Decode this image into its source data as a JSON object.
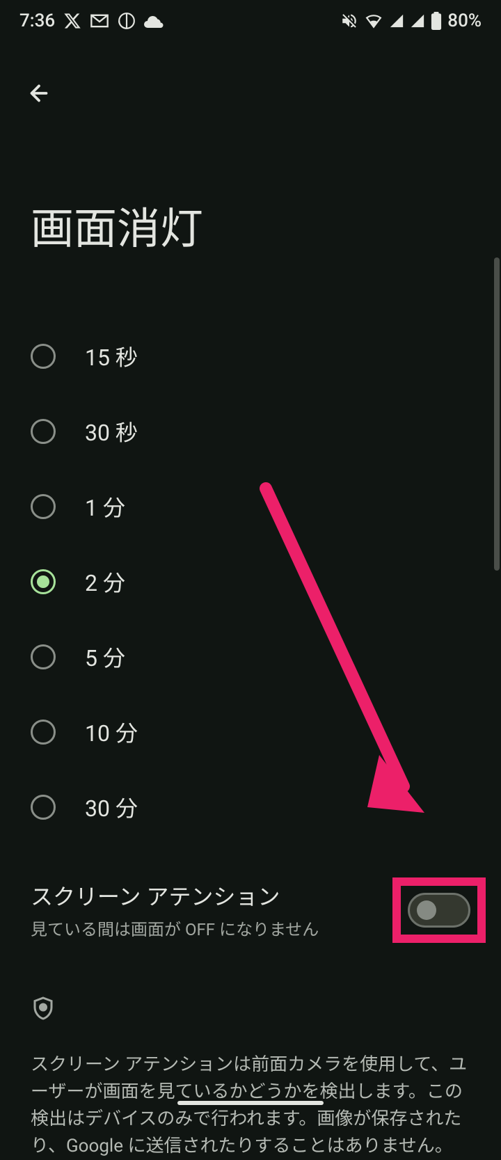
{
  "status_bar": {
    "time": "7:36",
    "battery": "80%"
  },
  "page_title": "画面消灯",
  "timeout_options": [
    {
      "label": "15 秒",
      "selected": false
    },
    {
      "label": "30 秒",
      "selected": false
    },
    {
      "label": "1 分",
      "selected": false
    },
    {
      "label": "2 分",
      "selected": true
    },
    {
      "label": "5 分",
      "selected": false
    },
    {
      "label": "10 分",
      "selected": false
    },
    {
      "label": "30 分",
      "selected": false
    }
  ],
  "screen_attention": {
    "title": "スクリーン アテンション",
    "subtitle": "見ている間は画面が OFF になりません",
    "enabled": false
  },
  "info_text": "スクリーン アテンションは前面カメラを使用して、ユーザーが画面を見ているかどうかを検出します。この検出はデバイスのみで行われます。画像が保存されたり、Google に送信されたりすることはありません。"
}
